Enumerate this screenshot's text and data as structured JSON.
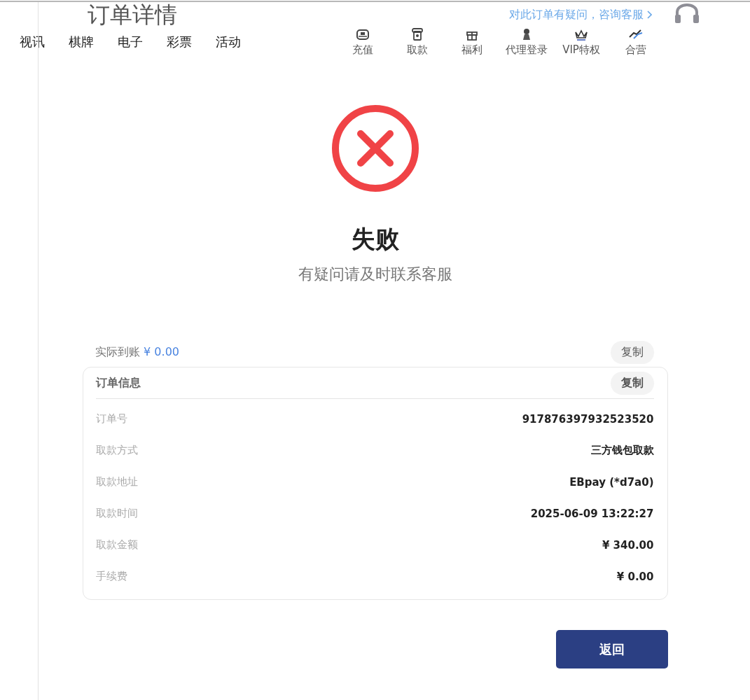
{
  "header": {
    "title": "订单详情",
    "help_link": "对此订单有疑问，咨询客服"
  },
  "nav": [
    {
      "label": "视讯"
    },
    {
      "label": "棋牌"
    },
    {
      "label": "电子"
    },
    {
      "label": "彩票"
    },
    {
      "label": "活动"
    }
  ],
  "quick_actions": [
    {
      "label": "充值",
      "kind": "deposit"
    },
    {
      "label": "取款",
      "kind": "withdraw"
    },
    {
      "label": "福利",
      "kind": "gift"
    },
    {
      "label": "代理登录",
      "kind": "agent"
    },
    {
      "label": "VIP特权",
      "kind": "vip"
    },
    {
      "label": "合营",
      "kind": "partner"
    }
  ],
  "result": {
    "status": "失败",
    "hint": "有疑问请及时联系客服"
  },
  "received": {
    "label": "实际到账",
    "amount": "¥ 0.00",
    "copy": "复制"
  },
  "order": {
    "title": "订单信息",
    "copy": "复制",
    "rows": [
      {
        "label": "订单号",
        "value": "917876397932523520"
      },
      {
        "label": "取款方式",
        "value": "三方钱包取款"
      },
      {
        "label": "取款地址",
        "value": "EBpay (*d7a0)"
      },
      {
        "label": "取款时间",
        "value": "2025-06-09 13:22:27"
      },
      {
        "label": "取款金额",
        "value": "¥ 340.00"
      },
      {
        "label": "手续费",
        "value": "¥ 0.00"
      }
    ]
  },
  "back_button": "返回"
}
